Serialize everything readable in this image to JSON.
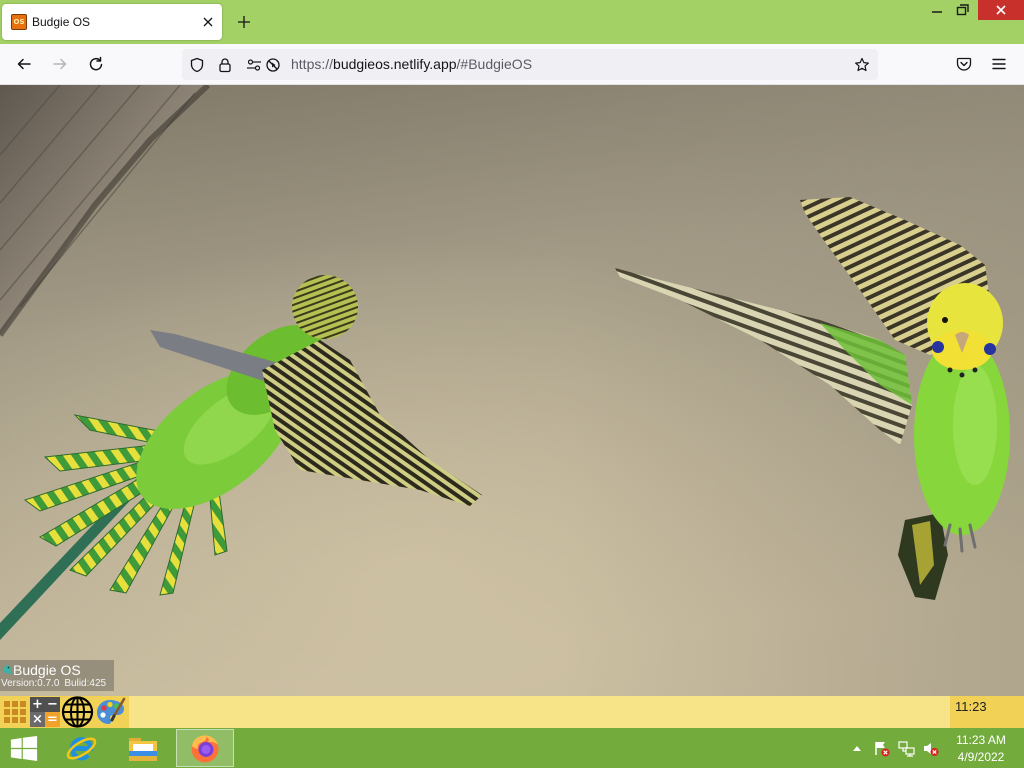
{
  "browser": {
    "tab": {
      "title": "Budgie OS",
      "favicon_text": "OS",
      "favicon_icon": "budgie-os-favicon-icon",
      "close_icon": "close-tab-icon"
    },
    "new_tab_icon": "plus-icon",
    "window_controls": {
      "minimize_icon": "minimize-icon",
      "restore_icon": "restore-icon",
      "close_icon": "close-window-icon"
    },
    "toolbar": {
      "back_icon": "back-arrow-icon",
      "forward_icon": "forward-arrow-icon",
      "forward_enabled": false,
      "reload_icon": "reload-icon",
      "url": {
        "scheme": "https://",
        "host": "budgieos.netlify.app",
        "path": "/#BudgieOS"
      },
      "url_bar_icons": [
        "shield-icon",
        "lock-icon",
        "permissions-icon",
        "autoplay-blocked-icon"
      ],
      "bookmark_icon": "star-icon",
      "pocket_icon": "pocket-icon",
      "menu_icon": "hamburger-menu-icon"
    }
  },
  "budgie_os": {
    "badge": {
      "logo_icon": "budgie-logo-icon",
      "name": "Budgie OS",
      "version": "Version:0.7.0",
      "build": "Bulid:425"
    },
    "taskbar": {
      "apps": [
        {
          "icon": "app-grid-icon"
        },
        {
          "icon": "calculator-icon",
          "glyphs": [
            "+",
            "−",
            "×",
            "="
          ]
        },
        {
          "icon": "globe-icon"
        },
        {
          "icon": "paint-icon"
        }
      ],
      "clock": "11:23"
    }
  },
  "windows_taskbar": {
    "start_icon": "windows-logo-icon",
    "pinned": [
      {
        "icon": "internet-explorer-icon",
        "active": false
      },
      {
        "icon": "file-explorer-icon",
        "active": false
      },
      {
        "icon": "firefox-icon",
        "active": true
      }
    ],
    "tray": {
      "icons": [
        "show-hidden-icons-icon",
        "action-center-icon",
        "network-icon",
        "volume-muted-icon"
      ],
      "time": "11:23 AM",
      "date": "4/9/2022"
    }
  },
  "colors": {
    "titlebar": "#a3d166",
    "windows_taskbar": "#73ab3d",
    "budgie_taskbar": "#f7e488",
    "budgie_taskbar_accent": "#f1d257",
    "close_button": "#c8312b"
  }
}
